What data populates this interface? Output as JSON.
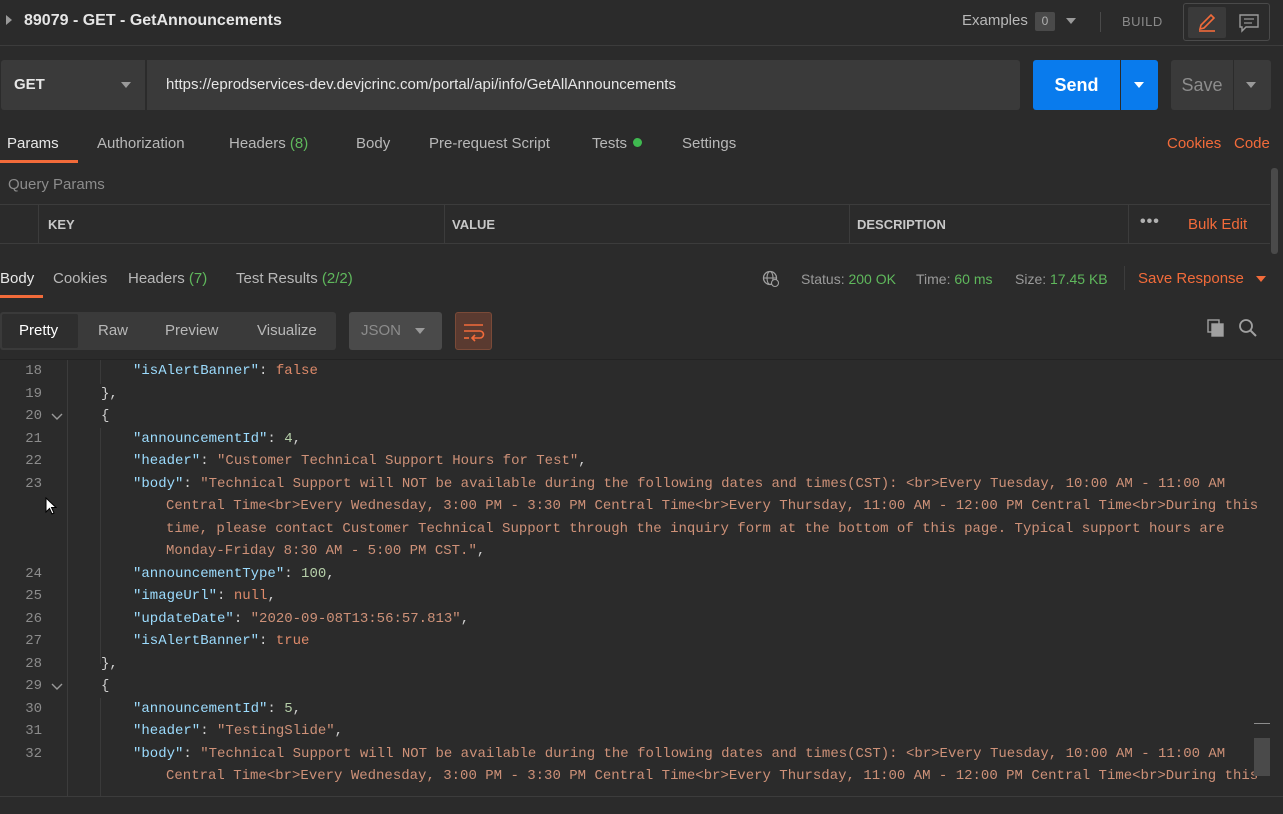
{
  "titlebar": {
    "title": "89079 - GET - GetAnnouncements",
    "examples_label": "Examples",
    "examples_count": "0",
    "build_label": "BUILD"
  },
  "request": {
    "method": "GET",
    "url": "https://eprodservices-dev.devjcrinc.com/portal/api/info/GetAllAnnouncements",
    "send_label": "Send",
    "save_label": "Save"
  },
  "request_tabs": {
    "params": "Params",
    "authorization": "Authorization",
    "headers": "Headers",
    "headers_count": "(8)",
    "body": "Body",
    "prerequest": "Pre-request Script",
    "tests": "Tests",
    "settings": "Settings",
    "cookies": "Cookies",
    "code": "Code"
  },
  "query_params": {
    "title": "Query Params",
    "columns": [
      "KEY",
      "VALUE",
      "DESCRIPTION"
    ],
    "more": "•••",
    "bulk_edit": "Bulk Edit"
  },
  "response_tabs": {
    "body": "Body",
    "cookies": "Cookies",
    "headers": "Headers",
    "headers_count": "(7)",
    "test_results": "Test Results",
    "test_results_count": "(2/2)"
  },
  "response_status": {
    "status_label": "Status:",
    "status_value": "200 OK",
    "time_label": "Time:",
    "time_value": "60 ms",
    "size_label": "Size:",
    "size_value": "17.45 KB",
    "save_response": "Save Response"
  },
  "view_toolbar": {
    "pretty": "Pretty",
    "raw": "Raw",
    "preview": "Preview",
    "visualize": "Visualize",
    "format": "JSON"
  },
  "colors": {
    "accent": "#f26b3a",
    "send_blue": "#097bed",
    "success_green": "#5fb85c"
  },
  "code_lines": {
    "l18": {
      "num": "18",
      "key": "\"isAlertBanner\"",
      "val": "false"
    },
    "l19": {
      "num": "19",
      "text": "},"
    },
    "l20": {
      "num": "20",
      "text": "{"
    },
    "l21": {
      "num": "21",
      "key": "\"announcementId\"",
      "val": "4"
    },
    "l22": {
      "num": "22",
      "key": "\"header\"",
      "val": "\"Customer Technical Support Hours for Test\""
    },
    "l23": {
      "num": "23",
      "key": "\"body\"",
      "val1": "\"Technical Support will NOT be available during the following dates and times(CST): <br>Every Tuesday, 10:00 AM - 11:00 AM",
      "val2": "Central Time<br>Every Wednesday, 3:00 PM - 3:30 PM Central Time<br>Every Thursday, 11:00 AM - 12:00 PM Central Time<br>During this",
      "val3": "time, please contact Customer Technical Support through the inquiry form at the bottom of this page. Typical support hours are",
      "val4": "Monday-Friday 8:30 AM - 5:00 PM CST.\""
    },
    "l24": {
      "num": "24",
      "key": "\"announcementType\"",
      "val": "100"
    },
    "l25": {
      "num": "25",
      "key": "\"imageUrl\"",
      "val": "null"
    },
    "l26": {
      "num": "26",
      "key": "\"updateDate\"",
      "val": "\"2020-09-08T13:56:57.813\""
    },
    "l27": {
      "num": "27",
      "key": "\"isAlertBanner\"",
      "val": "true"
    },
    "l28": {
      "num": "28",
      "text": "},"
    },
    "l29": {
      "num": "29",
      "text": "{"
    },
    "l30": {
      "num": "30",
      "key": "\"announcementId\"",
      "val": "5"
    },
    "l31": {
      "num": "31",
      "key": "\"header\"",
      "val": "\"TestingSlide\""
    },
    "l32": {
      "num": "32",
      "key": "\"body\"",
      "val1": "\"Technical Support will NOT be available during the following dates and times(CST): <br>Every Tuesday, 10:00 AM - 11:00 AM",
      "val2": "Central Time<br>Every Wednesday, 3:00 PM - 3:30 PM Central Time<br>Every Thursday, 11:00 AM - 12:00 PM Central Time<br>During this"
    }
  }
}
